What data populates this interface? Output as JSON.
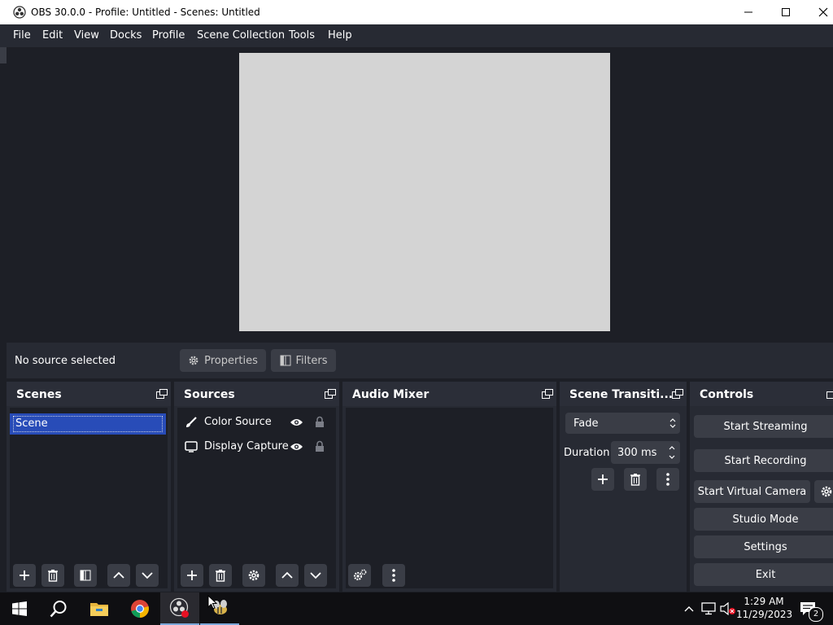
{
  "window": {
    "title": "OBS 30.0.0 - Profile: Untitled - Scenes: Untitled"
  },
  "menu": [
    "File",
    "Edit",
    "View",
    "Docks",
    "Profile",
    "Scene Collection",
    "Tools",
    "Help"
  ],
  "status": {
    "no_source": "No source selected",
    "properties_label": "Properties",
    "filters_label": "Filters"
  },
  "docks": {
    "scenes": {
      "title": "Scenes",
      "items": [
        "Scene"
      ]
    },
    "sources": {
      "title": "Sources",
      "items": [
        {
          "label": "Color Source",
          "icon": "brush-icon"
        },
        {
          "label": "Display Capture",
          "icon": "monitor-icon"
        }
      ]
    },
    "audio": {
      "title": "Audio Mixer"
    },
    "transitions": {
      "title": "Scene Transiti...",
      "selected": "Fade",
      "duration_label": "Duration",
      "duration_value": "300 ms"
    },
    "controls": {
      "title": "Controls",
      "start_streaming": "Start Streaming",
      "start_recording": "Start Recording",
      "start_virtual_camera": "Start Virtual Camera",
      "studio_mode": "Studio Mode",
      "settings": "Settings",
      "exit": "Exit"
    }
  },
  "taskbar": {
    "time": "1:29 AM",
    "date": "11/29/2023",
    "notification_count": "2",
    "icons": [
      "windows-start-icon",
      "search-icon",
      "file-explorer-icon",
      "chrome-icon",
      "obs-icon",
      "app-icon"
    ]
  },
  "colors": {
    "selection": "#284cb8",
    "panel": "#272a33",
    "background": "#1d1f26",
    "button": "#3a3d46",
    "canvas": "#d4d4d4"
  }
}
